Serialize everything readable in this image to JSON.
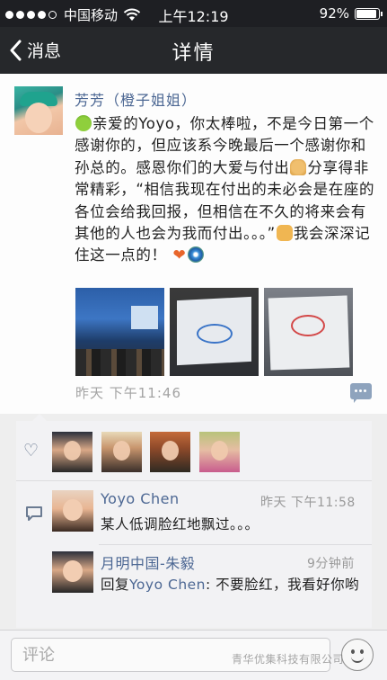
{
  "status_bar": {
    "carrier": "中国移动",
    "time": "上午12:19",
    "battery": "92%",
    "battery_level": 0.92,
    "signal_bars": 4,
    "icons": [
      "signal-icon",
      "wifi-icon",
      "battery-icon"
    ]
  },
  "nav": {
    "back_label": "消息",
    "title": "详情",
    "back_icon": "chevron-left-icon"
  },
  "post": {
    "author": "芳芳（橙子姐姐）",
    "text_parts": {
      "p1": "亲爱的Yoyo，你太棒啦，不是今日第一个感谢你的，但应该系今晚最后一个感谢你和孙总的。感恩你们的大爱与付出",
      "p2": "分享得非常精彩，“相信我现在付出的未必会是在座的各位会给我回报，但相信在不久的将来会有其他的人也会为我而付出。。。”",
      "p3": "我会深深记住这一点的！"
    },
    "emojis": [
      "frog-emoji",
      "pray-emoji",
      "thumbs-up-emoji",
      "heart-emoji",
      "swirl-emoji"
    ],
    "photos": [
      "meeting-photo",
      "presentation-slide-photo",
      "whiteboard-slide-photo"
    ],
    "time": "昨天 下午11:46"
  },
  "feedback": {
    "likes_icon": "heart-outline-icon",
    "like_avatars": 4,
    "comments": [
      {
        "name": "Yoyo Chen",
        "time": "昨天 下午11:58",
        "text": "某人低调脸红地飘过。。。"
      },
      {
        "name": "月明中国-朱毅",
        "time": "9分钟前",
        "reply_prefix": "回复",
        "reply_to": "Yoyo Chen",
        "text": ": 不要脸红，我看好你哟"
      }
    ]
  },
  "input_bar": {
    "placeholder": "评论",
    "emoji_icon": "smiley-face-icon"
  },
  "watermark": "青华优集科技有限公司",
  "colors": {
    "nav_bg": "#26282b",
    "link_blue": "#4c6793",
    "panel_bg": "#f2f2f4",
    "time_gray": "#a3a3a3"
  }
}
